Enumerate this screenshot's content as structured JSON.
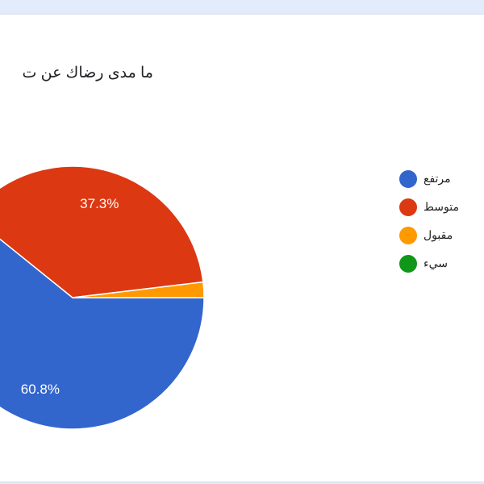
{
  "chart_data": {
    "type": "pie",
    "title": "ما مدى رضاك عن ت",
    "categories": [
      "مرتفع",
      "متوسط",
      "مقبول",
      "سيء"
    ],
    "values": [
      60.8,
      37.3,
      1.9,
      0
    ],
    "value_labels": [
      "60.8%",
      "37.3%",
      "",
      ""
    ],
    "colors": [
      "#3366cc",
      "#dc3912",
      "#ff9900",
      "#109618"
    ],
    "legend_position": "right"
  }
}
